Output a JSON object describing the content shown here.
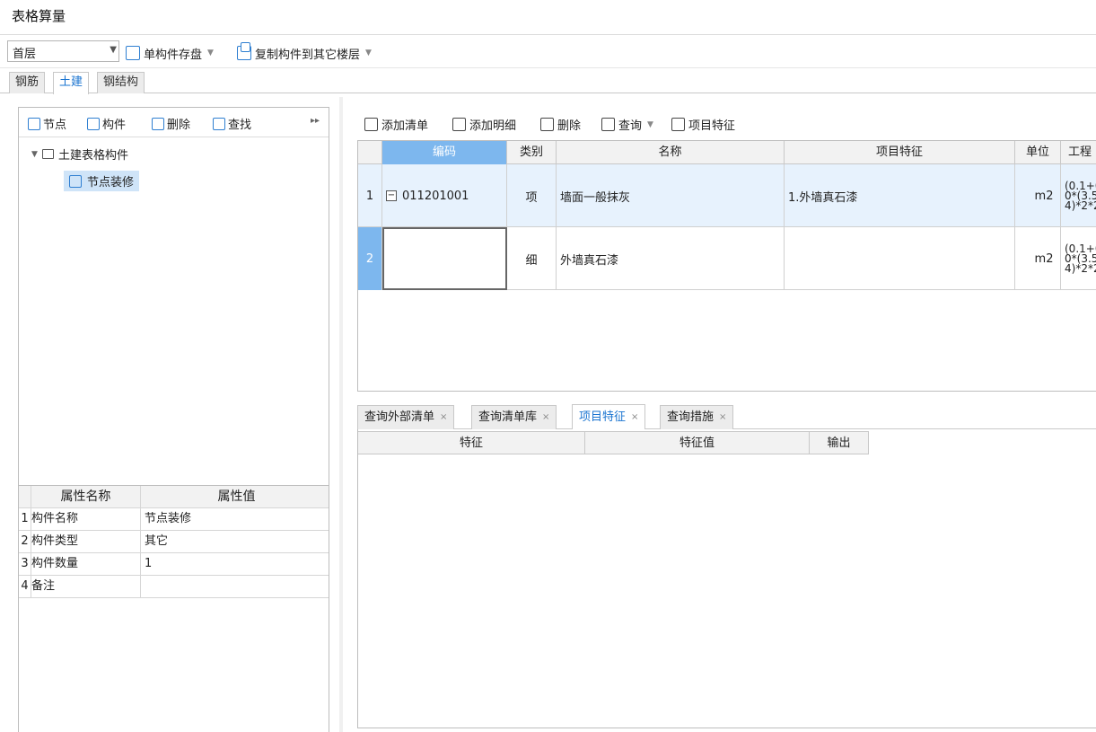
{
  "window": {
    "title": "表格算量"
  },
  "toolbar": {
    "floor_value": "首层",
    "save_single_label": "单构件存盘",
    "copy_to_floor_label": "复制构件到其它楼层"
  },
  "main_tabs": [
    {
      "label": "钢筋"
    },
    {
      "label": "土建"
    },
    {
      "label": "钢结构"
    }
  ],
  "left_toolbar": {
    "node_label": "节点",
    "component_label": "构件",
    "delete_label": "删除",
    "find_label": "查找"
  },
  "tree": {
    "root_label": "土建表格构件",
    "child_label": "节点装修"
  },
  "properties": {
    "header_name": "属性名称",
    "header_value": "属性值",
    "rows": [
      {
        "no": "1",
        "name": "构件名称",
        "value": "节点装修"
      },
      {
        "no": "2",
        "name": "构件类型",
        "value": "其它"
      },
      {
        "no": "3",
        "name": "构件数量",
        "value": "1"
      },
      {
        "no": "4",
        "name": "备注",
        "value": ""
      }
    ]
  },
  "right_toolbar": {
    "add_list_label": "添加清单",
    "add_detail_label": "添加明细",
    "delete_label": "删除",
    "query_label": "查询",
    "feature_label": "项目特征"
  },
  "grid": {
    "headers": {
      "code": "编码",
      "type": "类别",
      "name": "名称",
      "feature": "项目特征",
      "unit": "单位",
      "qty": "工程"
    },
    "rows": [
      {
        "no": "1",
        "code": "011201001",
        "type": "项",
        "name": "墙面一般抹灰",
        "feature": "1.外墙真石漆",
        "unit": "m2",
        "qty": "(0.1+0\n0*(3.5\n4)*2*2"
      },
      {
        "no": "2",
        "code": "",
        "type": "细",
        "name": "外墙真石漆",
        "feature": "",
        "unit": "m2",
        "qty": "(0.1+0\n0*(3.5\n4)*2*2"
      }
    ]
  },
  "bottom_tabs": [
    {
      "label": "查询外部清单"
    },
    {
      "label": "查询清单库"
    },
    {
      "label": "项目特征"
    },
    {
      "label": "查询措施"
    }
  ],
  "feature_table": {
    "h_feature": "特征",
    "h_value": "特征值",
    "h_output": "输出"
  }
}
